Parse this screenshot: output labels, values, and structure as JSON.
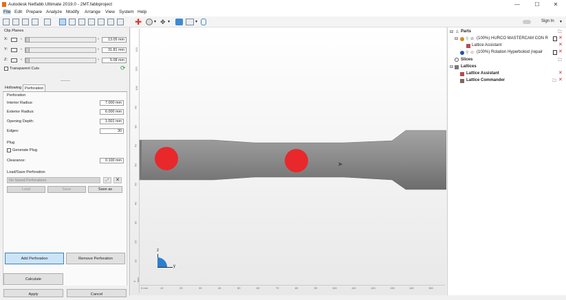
{
  "window": {
    "title": "Autodesk Netfabb Ultimate 2019.0 - 2MT.fabbproject",
    "controls": [
      "—",
      "☐",
      "✕"
    ]
  },
  "menu": [
    "File",
    "Edit",
    "Prepare",
    "Analyze",
    "Modify",
    "Arrange",
    "View",
    "System",
    "Help"
  ],
  "user": {
    "label": "Sign In"
  },
  "clip_planes": {
    "title": "Clip Planes",
    "axes": [
      {
        "label": "X:",
        "value": "13.05 mm"
      },
      {
        "label": "Y:",
        "value": "31.81 mm"
      },
      {
        "label": "Z:",
        "value": "5.08 mm"
      }
    ],
    "transparent_cuts": "Transparent Cuts"
  },
  "tabs": [
    "Hollowing",
    "Perforation"
  ],
  "perforation": {
    "section": "Perforation",
    "fields": [
      {
        "label": "Interior Radius:",
        "value": "7.000 mm"
      },
      {
        "label": "Exterior Radius:",
        "value": "6.000 mm"
      },
      {
        "label": "Opening Depth:",
        "value": "1.001 mm"
      },
      {
        "label": "Edges:",
        "value": "30"
      }
    ]
  },
  "plug": {
    "section": "Plug",
    "generate_label": "Generate Plug",
    "clearance_label": "Clearance:",
    "clearance_value": "0.100 mm"
  },
  "load_save": {
    "section": "Load/Save Perforation",
    "select_value": "No Saved Perforations",
    "load": "Load",
    "save": "Save",
    "save_as": "Save as"
  },
  "buttons": {
    "add_perforation": "Add Perforation",
    "remove_perforation": "Remove Perforation",
    "calculate": "Calculate",
    "apply": "Apply",
    "cancel": "Cancel"
  },
  "viewport": {
    "axis_z": "z",
    "axis_y": "y",
    "ruler_h": [
      "0 mm",
      "10",
      "20",
      "30",
      "40",
      "50",
      "60",
      "70",
      "80",
      "90",
      "100",
      "110",
      "120",
      "130",
      "140",
      "150"
    ],
    "ruler_v": [
      "0 mm",
      "10",
      "20",
      "30",
      "40",
      "50",
      "60",
      "70",
      "80",
      "90",
      "100",
      "110",
      "120"
    ],
    "colors": {
      "part": "#8c8c8c",
      "marker": "#e8282b"
    }
  },
  "tree": {
    "parts": "Parts",
    "part1": "(100%) HURCO MASTERCAM CON R",
    "lattice_assistant_child": "Lattice Assistant",
    "part2": "(100%) Rotation Hyperboloid (repair",
    "slices": "Slices",
    "lattices": "Lattices",
    "lattice_assistant": "Lattice Assistant",
    "lattice_commander": "Lattice Commander"
  }
}
